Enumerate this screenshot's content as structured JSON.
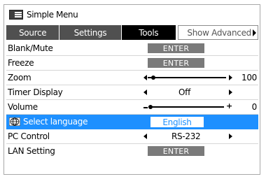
{
  "window": {
    "title": "Simple Menu",
    "icon": "menu-list-icon"
  },
  "tabs": [
    {
      "label": "Source",
      "active": false
    },
    {
      "label": "Settings",
      "active": false
    },
    {
      "label": "Tools",
      "active": true
    },
    {
      "label": "Show Advanced",
      "active": false
    }
  ],
  "rows": {
    "blank_mute": {
      "label": "Blank/Mute",
      "button": "ENTER"
    },
    "freeze": {
      "label": "Freeze",
      "button": "ENTER"
    },
    "zoom": {
      "label": "Zoom",
      "value": "100",
      "level": 0.05
    },
    "timer_display": {
      "label": "Timer Display",
      "value": "Off"
    },
    "volume": {
      "label": "Volume",
      "value": "0",
      "level": 0.0
    },
    "select_language": {
      "label": "Select language",
      "value": "English",
      "icon": "globe-language-icon",
      "selected": true
    },
    "pc_control": {
      "label": "PC Control",
      "value": "RS-232"
    },
    "lan_setting": {
      "label": "LAN Setting",
      "button": "ENTER"
    }
  },
  "colors": {
    "selection": "#1e90ff",
    "button": "#7a7a7a",
    "active_tab": "#000000",
    "inactive_tab": "#505050"
  }
}
